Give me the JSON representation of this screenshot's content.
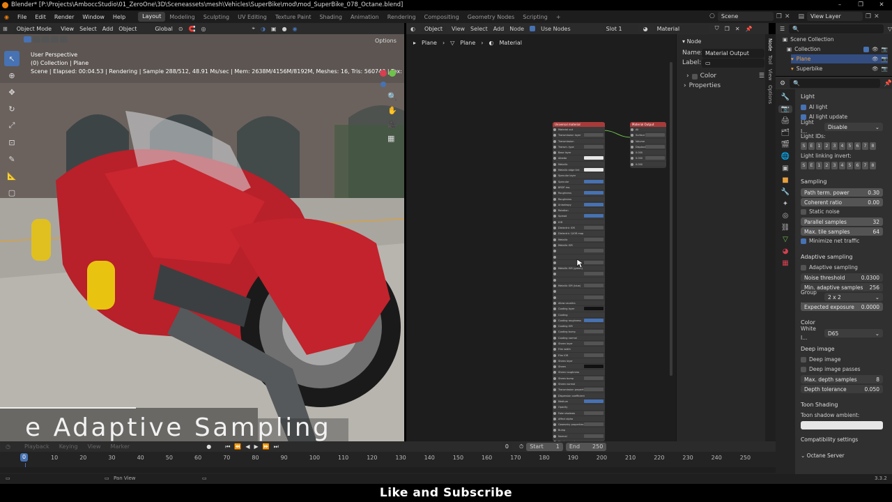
{
  "window": {
    "title": "Blender* [P:\\Projects\\AmboccStudio\\01_ZeroOne\\3D\\Sceneassets\\mesh\\Vehicles\\SuperBike\\mod\\mod_SuperBike_078_Octane.blend]"
  },
  "menu": {
    "items": [
      "File",
      "Edit",
      "Render",
      "Window",
      "Help"
    ]
  },
  "workspaces": [
    "Layout",
    "Modeling",
    "Sculpting",
    "UV Editing",
    "Texture Paint",
    "Shading",
    "Animation",
    "Rendering",
    "Compositing",
    "Geometry Nodes",
    "Scripting"
  ],
  "topright": {
    "scene": "Scene",
    "view_layer": "View Layer"
  },
  "viewport": {
    "mode": "Object Mode",
    "menus": [
      "View",
      "Select",
      "Add",
      "Object"
    ],
    "transform": "Global",
    "options": "Options",
    "perspective": "User Perspective",
    "collection": "(0) Collection | Plane",
    "stats": "Scene | Elapsed: 00:04.53 | Rendering | Sample 288/512, 48.91 Ms/sec | Mem: 2638M/4156M/8192M, Meshes: 16, Tris: 560740 | Tex: ( Rgb: 32, R: 4, 13"
  },
  "node_editor": {
    "type": "Object",
    "menus": [
      "View",
      "Select",
      "Add",
      "Node"
    ],
    "use_nodes": "Use Nodes",
    "slot": "Slot 1",
    "material": "Material",
    "breadcrumb": [
      "Plane",
      "Plane",
      "Material"
    ],
    "node1_title": "Universal material",
    "node2_title": "Material Output",
    "node1_rows": [
      "Material out",
      "Transmission layer",
      "Transmission",
      "Transm. type",
      "Base layer",
      "Albedo",
      "Metallic",
      "Metallic edge tint",
      "Specular layer",
      "Specular",
      "BRDF mo.",
      "Roughness",
      "Roughness",
      "Anisotropy",
      "Rotation",
      "Spread",
      "IOR",
      "Dielectric IOR",
      "Dielectric 1/IOR map",
      "Metallic",
      "Metallic IOR",
      "",
      "",
      "",
      "Metallic IOR (green)",
      "",
      "",
      "Metallic IOR (blue)",
      "",
      "",
      "Allow caustics",
      "Coating layer",
      "Coating",
      "Coating roughness",
      "Coating IOR",
      "Coating bump",
      "Coating normal",
      "Sheen layer",
      "Film width",
      "Film IOR",
      "Sheen layer",
      "Sheen",
      "Sheen roughness",
      "Sheen bump",
      "Sheen normal",
      "Transmission properties",
      "Dispersion coefficient",
      "Medium",
      "Opacity",
      "Fake shadows",
      "Affect alpha",
      "Geometry properties",
      "Bump",
      "Normal",
      "Displacement"
    ],
    "node2_rows": [
      "All",
      "Surface",
      "Volume",
      "Displacement",
      "0.000",
      "0.000",
      "0.000"
    ]
  },
  "npanel": {
    "section": "Node",
    "name_label": "Name:",
    "name_value": "Material Output",
    "label_label": "Label:",
    "color": "Color",
    "properties": "Properties",
    "tabs": [
      "Node",
      "Tool",
      "View",
      "Options"
    ]
  },
  "outliner": {
    "items": [
      {
        "label": "Scene Collection"
      },
      {
        "label": "Collection"
      },
      {
        "label": "Plane"
      },
      {
        "label": "Superbike"
      }
    ]
  },
  "properties": {
    "light_section": "Light",
    "ai_light": "AI light",
    "ai_light_update": "AI light update",
    "light_label": "Light I...",
    "light_value": "Disable",
    "light_ids": "Light IDs:",
    "light_linking": "Light linking invert:",
    "id_buttons": [
      "S",
      "E",
      "1",
      "2",
      "3",
      "4",
      "5",
      "6",
      "7",
      "8"
    ],
    "sampling": "Sampling",
    "path_term": {
      "label": "Path term. power",
      "value": "0.30"
    },
    "coherent": {
      "label": "Coherent ratio",
      "value": "0.00"
    },
    "static_noise": "Static noise",
    "parallel": {
      "label": "Parallel samples",
      "value": "32"
    },
    "max_tile": {
      "label": "Max. tile samples",
      "value": "64"
    },
    "minimize": "Minimize net traffic",
    "adaptive_section": "Adaptive sampling",
    "adaptive": "Adaptive sampling",
    "noise_threshold": {
      "label": "Noise threshold",
      "value": "0.0300"
    },
    "min_adaptive": {
      "label": "Min. adaptive samples",
      "value": "256"
    },
    "group_label": "Group ...",
    "group_value": "2 x 2",
    "expected": {
      "label": "Expected exposure",
      "value": "0.0000"
    },
    "color_section": "Color",
    "white_label": "White I...",
    "white_value": "D65",
    "deep_section": "Deep image",
    "deep_image": "Deep image",
    "deep_passes": "Deep image passes",
    "max_depth": {
      "label": "Max. depth samples",
      "value": "8"
    },
    "depth_tol": {
      "label": "Depth tolerance",
      "value": "0.050"
    },
    "toon_section": "Toon Shading",
    "toon_ambient": "Toon shadow ambient:",
    "compat": "Compatibility settings",
    "octane_server": "Octane Server"
  },
  "timeline": {
    "menus": [
      "Playback",
      "Keying",
      "View",
      "Marker"
    ],
    "current_frame": "0",
    "start_label": "Start",
    "start": "1",
    "end_label": "End",
    "end": "250",
    "ticks": [
      "10",
      "20",
      "30",
      "40",
      "50",
      "60",
      "70",
      "80",
      "90",
      "100",
      "110",
      "120",
      "130",
      "140",
      "150",
      "160",
      "170",
      "180",
      "190",
      "200",
      "210",
      "220",
      "230",
      "240",
      "250"
    ],
    "cursor": "0"
  },
  "status": {
    "pan_view": "Pan View",
    "version": "3.3.2"
  },
  "overlay_text": "e Adaptive Sampling",
  "bottom_banner": "Like and Subscribe",
  "colors": {
    "accent": "#4772b3",
    "selection": "#e87d0d"
  }
}
